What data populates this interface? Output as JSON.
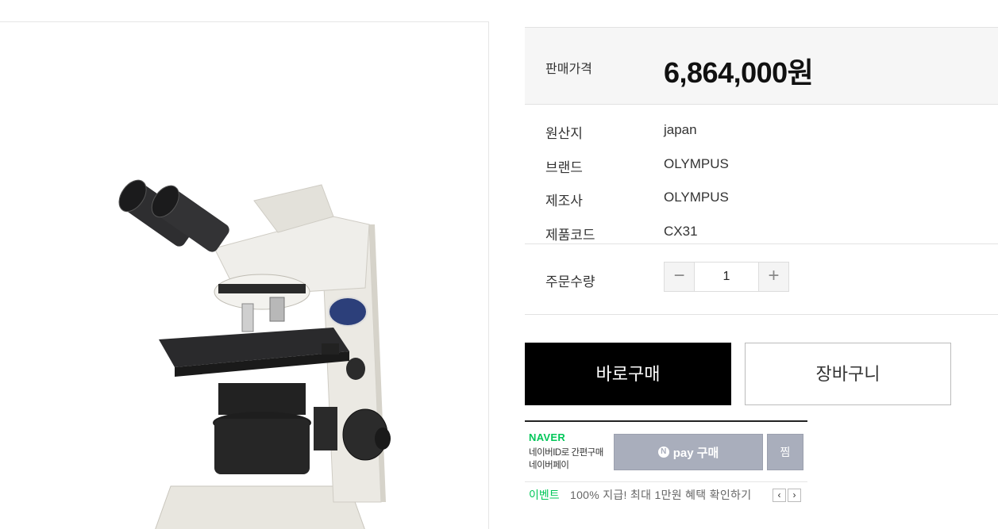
{
  "product_image": {
    "alt": "OLYMPUS CX31 microscope"
  },
  "price": {
    "label": "판매가격",
    "value": "6,864,000원"
  },
  "specs": [
    {
      "label": "원산지",
      "value": "japan"
    },
    {
      "label": "브랜드",
      "value": "OLYMPUS"
    },
    {
      "label": "제조사",
      "value": "OLYMPUS"
    },
    {
      "label": "제품코드",
      "value": "CX31"
    }
  ],
  "quantity": {
    "label": "주문수량",
    "value": "1",
    "minus_icon": "minus-icon",
    "plus_icon": "plus-icon"
  },
  "actions": {
    "buy_now": "바로구매",
    "cart": "장바구니"
  },
  "naver_pay": {
    "logo": "NAVER",
    "desc_line1": "네이버ID로 간편구매",
    "desc_line2": "네이버페이",
    "pay_badge": "N",
    "pay_label": "pay 구매",
    "zzim": "찜",
    "event_tag": "이벤트",
    "event_text": "100% 지급! 최대 1만원 혜택 확인하기",
    "prev_icon": "chevron-left-icon",
    "next_icon": "chevron-right-icon"
  },
  "colors": {
    "naver_green": "#03c75a",
    "buy_bg": "#000000",
    "npay_gray": "#a9aebc"
  }
}
